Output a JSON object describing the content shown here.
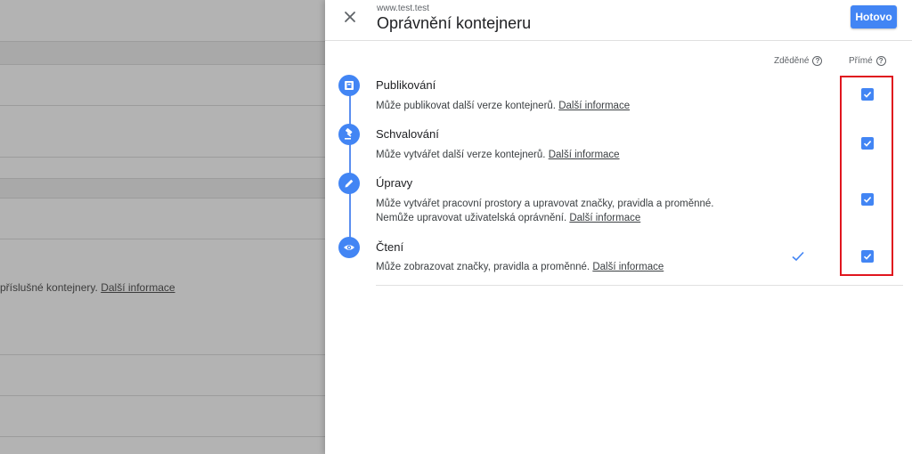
{
  "background": {
    "text": "příslušné kontejnery.",
    "link": "Další informace"
  },
  "panel": {
    "subtitle": "www.test.test",
    "title": "Oprávnění kontejneru",
    "done_label": "Hotovo",
    "col_inherited": "Zděděné",
    "col_direct": "Přímé",
    "help_glyph": "?",
    "permissions": [
      {
        "title": "Publikování",
        "description": "Může publikovat další verze kontejnerů.",
        "link": "Další informace",
        "icon": "publish-icon",
        "inherited_checked": false,
        "direct_checked": true
      },
      {
        "title": "Schvalování",
        "description": "Může vytvářet další verze kontejnerů.",
        "link": "Další informace",
        "icon": "gavel-icon",
        "inherited_checked": false,
        "direct_checked": true
      },
      {
        "title": "Úpravy",
        "description": "Může vytvářet pracovní prostory a upravovat značky, pravidla a proměnné. Nemůže upravovat uživatelská oprávnění.",
        "link": "Další informace",
        "icon": "pencil-icon",
        "inherited_checked": false,
        "direct_checked": true
      },
      {
        "title": "Čtení",
        "description": "Může zobrazovat značky, pravidla a proměnné.",
        "link": "Další informace",
        "icon": "eye-icon",
        "inherited_checked": true,
        "direct_checked": true
      }
    ]
  },
  "colors": {
    "accent": "#4285f4",
    "highlight": "#e0161e",
    "overlay": "#b3b3b3"
  }
}
